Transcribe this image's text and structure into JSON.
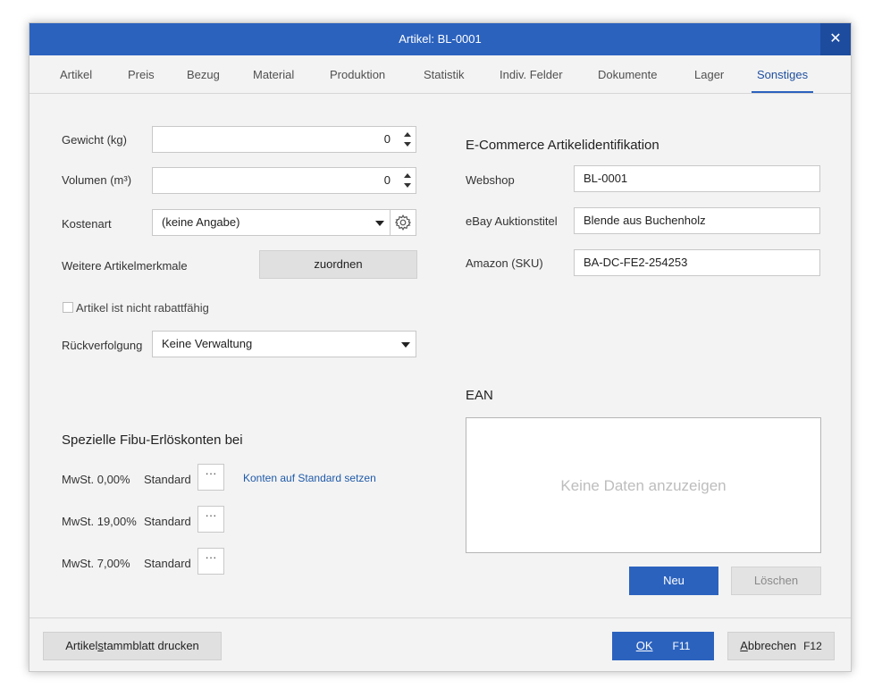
{
  "window": {
    "title": "Artikel: BL-0001",
    "close_label": "✕"
  },
  "tabs": [
    {
      "label": "Artikel"
    },
    {
      "label": "Preis"
    },
    {
      "label": "Bezug"
    },
    {
      "label": "Material"
    },
    {
      "label": "Produktion"
    },
    {
      "label": "Statistik"
    },
    {
      "label": "Indiv. Felder"
    },
    {
      "label": "Dokumente"
    },
    {
      "label": "Lager"
    },
    {
      "label": "Sonstiges"
    }
  ],
  "active_tab": "Sonstiges",
  "left": {
    "gewicht": {
      "label": "Gewicht (kg)",
      "value": "0"
    },
    "volumen": {
      "label": "Volumen (m³)",
      "value": "0"
    },
    "kostenart": {
      "label": "Kostenart",
      "value": "(keine Angabe)"
    },
    "merkmale": {
      "label": "Weitere Artikelmerkmale",
      "button": "zuordnen"
    },
    "rabatt": {
      "label": "Artikel ist nicht rabattfähig",
      "checked": false
    },
    "rueckverfolgung": {
      "label": "Rückverfolgung",
      "value": "Keine Verwaltung"
    }
  },
  "fibu": {
    "heading": "Spezielle Fibu-Erlöskonten bei",
    "rows": [
      {
        "label": "MwSt. 0,00%",
        "value": "Standard"
      },
      {
        "label": "MwSt. 19,00%",
        "value": "Standard"
      },
      {
        "label": "MwSt. 7,00%",
        "value": "Standard"
      }
    ],
    "dots": "···",
    "reset_link": "Konten auf Standard setzen"
  },
  "ecommerce": {
    "heading": "E-Commerce Artikelidentifikation",
    "webshop": {
      "label": "Webshop",
      "value": "BL-0001"
    },
    "ebay": {
      "label": "eBay Auktionstitel",
      "value": "Blende aus Buchenholz"
    },
    "amazon": {
      "label": "Amazon (SKU)",
      "value": "BA-DC-FE2-254253"
    }
  },
  "ean": {
    "heading": "EAN",
    "empty_text": "Keine Daten anzuzeigen",
    "new_button": "Neu",
    "delete_button": "Löschen"
  },
  "footer": {
    "print_button_pre": "Artikel",
    "print_button_u": "s",
    "print_button_post": "tammblatt drucken",
    "ok_label": "OK",
    "ok_shortcut": "F11",
    "cancel_u": "A",
    "cancel_rest": "bbrechen",
    "cancel_shortcut": "F12"
  },
  "colors": {
    "accent": "#2b62be",
    "accent_dark": "#1d4c9f",
    "link": "#1f5aa8",
    "background": "#f3f3f3"
  }
}
